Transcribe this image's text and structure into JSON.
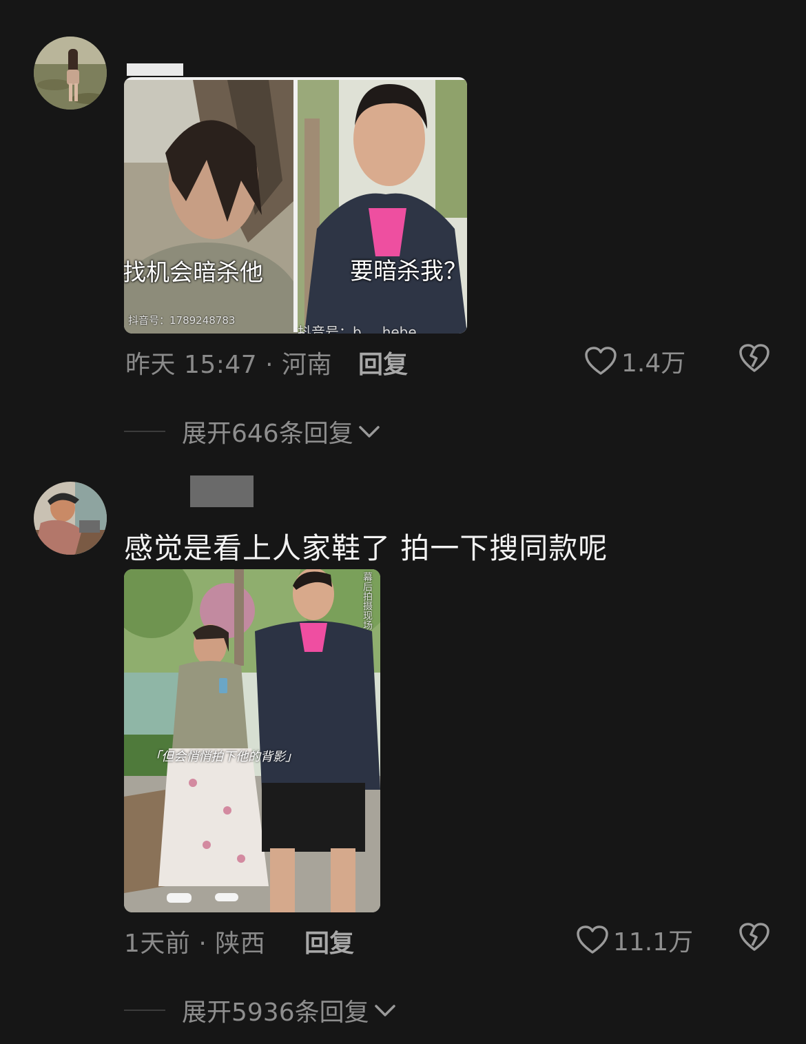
{
  "comments": [
    {
      "image": {
        "left_caption": "找机会暗杀他",
        "right_caption": "要暗杀我？",
        "left_watermark": "抖音号：1789248783",
        "right_watermark": "抖音号：b___hebe"
      },
      "time_location": "昨天 15:47 · 河南",
      "reply_label": "回复",
      "likes": "1.4万",
      "expand_label": "展开646条回复"
    },
    {
      "text": "感觉是看上人家鞋了 拍一下搜同款呢",
      "image": {
        "subtitle": "「但会悄悄拍下他的背影」",
        "side_text": "幕后拍摄现场"
      },
      "time_location": "1天前 · 陕西",
      "reply_label": "回复",
      "likes": "11.1万",
      "expand_label": "展开5936条回复"
    }
  ],
  "icons": {
    "like": "heart-outline-icon",
    "dislike": "broken-heart-icon",
    "expand": "chevron-down-icon"
  },
  "colors": {
    "background": "#161616",
    "muted_text": "#8a8a8a",
    "comment_text": "#f2f2f2"
  }
}
